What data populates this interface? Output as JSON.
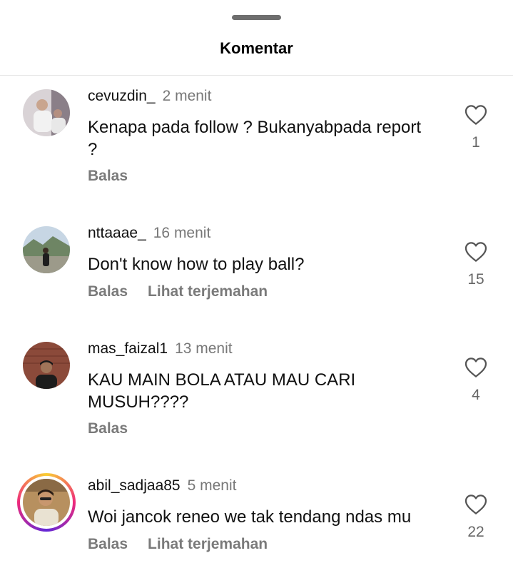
{
  "header": {
    "title": "Komentar"
  },
  "comments": [
    {
      "username": "cevuzdin_",
      "time": "2 menit",
      "text": "Kenapa pada follow ? Bukanyabpada report ?",
      "reply": "Balas",
      "translate": "",
      "likes": "1",
      "story_ring": false
    },
    {
      "username": "nttaaae_",
      "time": "16 menit",
      "text": "Don't know how to play ball?",
      "reply": "Balas",
      "translate": "Lihat terjemahan",
      "likes": "15",
      "story_ring": false
    },
    {
      "username": "mas_faizal1",
      "time": "13 menit",
      "text": "KAU MAIN BOLA ATAU MAU CARI MUSUH????",
      "reply": "Balas",
      "translate": "",
      "likes": "4",
      "story_ring": false
    },
    {
      "username": "abil_sadjaa85",
      "time": "5 menit",
      "text": "Woi jancok reneo we tak tendang ndas mu",
      "reply": "Balas",
      "translate": "Lihat terjemahan",
      "likes": "22",
      "story_ring": true
    }
  ],
  "icons": {
    "like": "heart-outline-icon",
    "handle": "drag-handle"
  },
  "colors": {
    "muted": "#7a7a7a",
    "divider": "#e4e4e4",
    "ring": [
      "#f9ce34",
      "#ee2a7b",
      "#6228d7"
    ]
  }
}
